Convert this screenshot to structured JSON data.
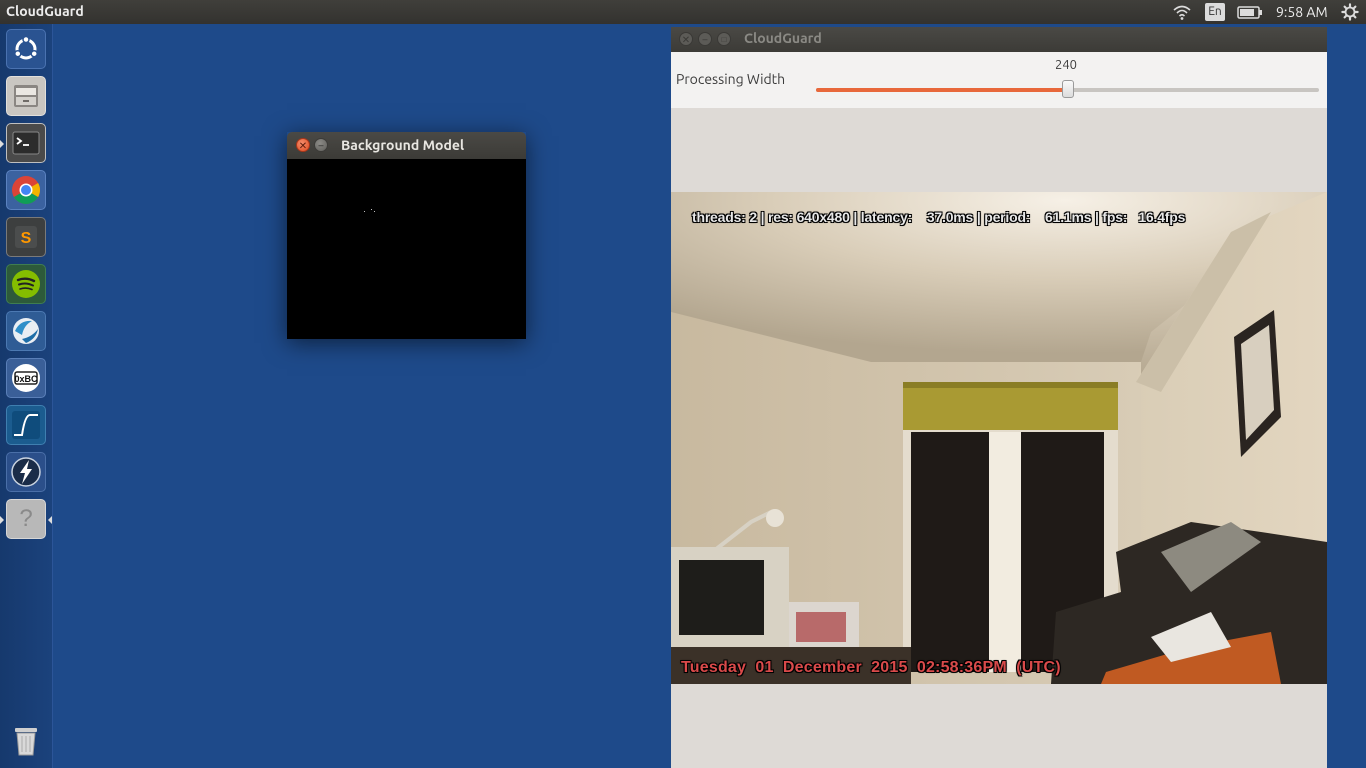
{
  "topbar": {
    "app_title": "CloudGuard",
    "language": "En",
    "clock": "9:58 AM",
    "icons": [
      "wifi-icon",
      "battery-icon",
      "gear-icon"
    ]
  },
  "launcher": {
    "items": [
      {
        "name": "ubuntu-dash-icon"
      },
      {
        "name": "files-icon"
      },
      {
        "name": "terminal-icon"
      },
      {
        "name": "chrome-icon"
      },
      {
        "name": "sublime-text-icon"
      },
      {
        "name": "spotify-icon"
      },
      {
        "name": "globe-app-icon"
      },
      {
        "name": "hex-editor-icon",
        "label": "0xBC"
      },
      {
        "name": "oscilloscope-icon"
      },
      {
        "name": "lightning-icon"
      },
      {
        "name": "unknown-app-icon",
        "label": "?"
      },
      {
        "name": "trash-icon"
      }
    ]
  },
  "background_window": {
    "title": "Background Model"
  },
  "main_window": {
    "title": "CloudGuard",
    "processing_width": {
      "label": "Processing Width",
      "value": "240",
      "level": 0.5
    },
    "stats_overlay": "threads: 2 | res: 640x480 | latency:    37.0ms | period:    61.1ms | fps:   16.4fps",
    "timestamp_overlay": "Tuesday  01  December  2015  02:58:36PM  (UTC)"
  },
  "colors": {
    "desktop": "#1e4a8a",
    "slider_fill": "#e8683b",
    "timestamp": "#d94a4a"
  }
}
